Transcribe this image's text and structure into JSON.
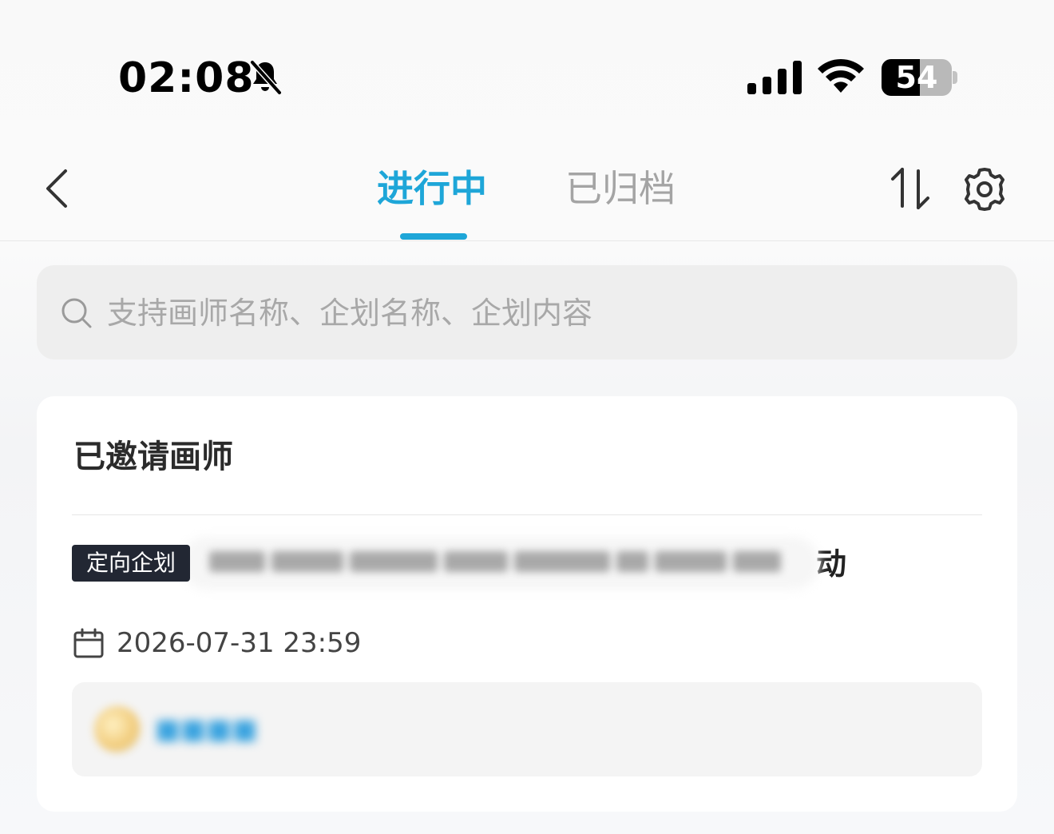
{
  "status_bar": {
    "time": "02:08",
    "battery_percent": "54",
    "battery_level": 0.54,
    "icons": [
      "bell-muted-icon",
      "cellular-signal-icon",
      "wifi-icon",
      "battery-icon"
    ]
  },
  "nav": {
    "tabs": [
      {
        "label": "进行中",
        "active": true
      },
      {
        "label": "已归档",
        "active": false
      }
    ],
    "accent_color": "#1ea6d8",
    "icons": [
      "back-chevron-icon",
      "sort-icon",
      "gear-icon"
    ]
  },
  "search": {
    "placeholder": "支持画师名称、企划名称、企划内容",
    "value": ""
  },
  "card": {
    "title": "已邀请画师",
    "project": {
      "tag": "定向企划",
      "title_visible_end": "动"
    },
    "deadline": "2026-07-31 23:59"
  }
}
